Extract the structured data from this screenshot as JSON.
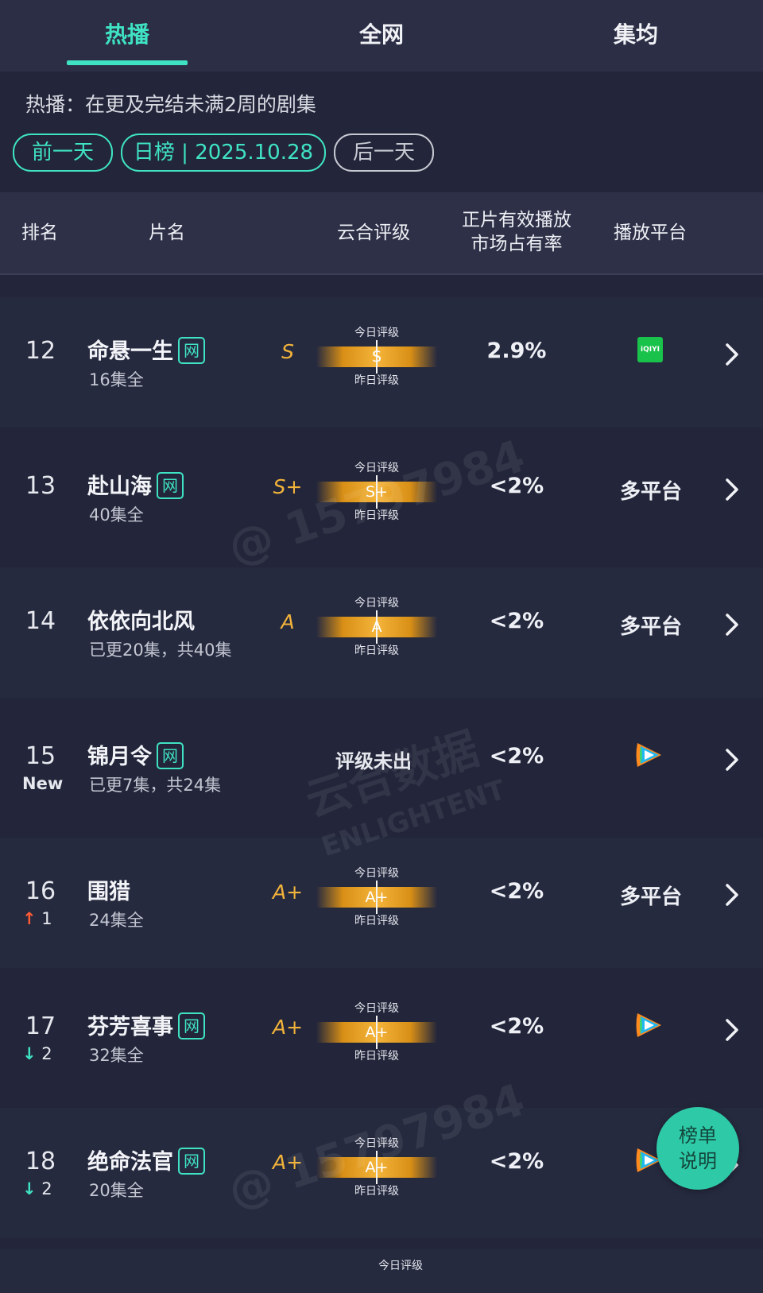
{
  "tabs": [
    "热播",
    "全网",
    "集均"
  ],
  "description": "热播：在更及完结未满2周的剧集",
  "date_nav": {
    "prev": "前一天",
    "current": "日榜 | 2025.10.28",
    "next": "后一天"
  },
  "table_header": {
    "rank": "排名",
    "title": "片名",
    "rating": "云合评级",
    "share_line1": "正片有效播放",
    "share_line2": "市场占有率",
    "platform": "播放平台"
  },
  "gauge_labels": {
    "today": "今日评级",
    "yesterday": "昨日评级"
  },
  "rows": [
    {
      "rank": "12",
      "change": "",
      "change_dir": "",
      "title": "命悬一生",
      "wang": "网",
      "episodes": "16集全",
      "grade": "S",
      "gauge": "S",
      "share": "2.9%",
      "platform_type": "iqiyi",
      "platform": "iQIYI"
    },
    {
      "rank": "13",
      "change": "",
      "change_dir": "",
      "title": "赴山海",
      "wang": "网",
      "episodes": "40集全",
      "grade": "S+",
      "gauge": "S+",
      "share": "<2%",
      "platform_type": "text",
      "platform": "多平台"
    },
    {
      "rank": "14",
      "change": "",
      "change_dir": "",
      "title": "依依向北风",
      "wang": "",
      "episodes": "已更20集，共40集",
      "grade": "A",
      "gauge": "A",
      "share": "<2%",
      "platform_type": "text",
      "platform": "多平台"
    },
    {
      "rank": "15",
      "change": "New",
      "change_dir": "new",
      "title": "锦月令",
      "wang": "网",
      "episodes": "已更7集，共24集",
      "grade": "",
      "gauge": "",
      "no_grade": "评级未出",
      "share": "<2%",
      "platform_type": "tencent",
      "platform": ""
    },
    {
      "rank": "16",
      "change": "1",
      "change_dir": "up",
      "title": "围猎",
      "wang": "",
      "episodes": "24集全",
      "grade": "A+",
      "gauge": "A+",
      "share": "<2%",
      "platform_type": "text",
      "platform": "多平台"
    },
    {
      "rank": "17",
      "change": "2",
      "change_dir": "down",
      "title": "芬芳喜事",
      "wang": "网",
      "episodes": "32集全",
      "grade": "A+",
      "gauge": "A+",
      "share": "<2%",
      "platform_type": "tencent",
      "platform": ""
    },
    {
      "rank": "18",
      "change": "2",
      "change_dir": "down",
      "title": "绝命法官",
      "wang": "网",
      "episodes": "20集全",
      "grade": "A+",
      "gauge": "A+",
      "share": "<2%",
      "platform_type": "tencent",
      "platform": ""
    }
  ],
  "legend_button": {
    "line1": "榜单",
    "line2": "说明"
  },
  "watermarks": [
    "@ 15797984",
    "云合数据",
    "ENLIGHTENT"
  ],
  "colors": {
    "accent": "#3fe3c4",
    "grade": "#f2b33a",
    "up": "#ff5a36",
    "down": "#3fe3c4",
    "iqiyi": "#19c24a"
  }
}
